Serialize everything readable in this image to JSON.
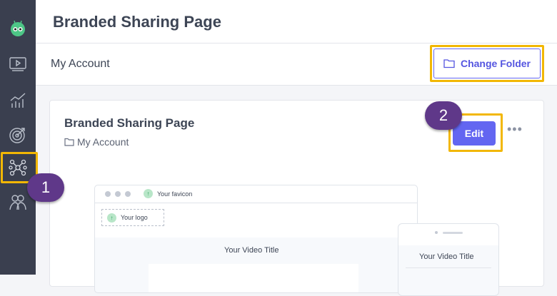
{
  "header": {
    "title": "Branded Sharing Page"
  },
  "subheader": {
    "title": "My Account",
    "change_folder_label": "Change Folder"
  },
  "card": {
    "title": "Branded Sharing Page",
    "folder": "My Account",
    "edit_label": "Edit",
    "more_label": "•••"
  },
  "preview": {
    "favicon_label": "Your favicon",
    "logo_label": "Your logo",
    "video_title": "Your Video Title",
    "mobile_video_title": "Your Video Title"
  },
  "callouts": {
    "one": "1",
    "two": "2"
  },
  "sidebar": {
    "items": [
      {
        "icon": "logo-icon"
      },
      {
        "icon": "video-icon"
      },
      {
        "icon": "analytics-icon"
      },
      {
        "icon": "target-icon"
      },
      {
        "icon": "integrations-icon",
        "active": true
      },
      {
        "icon": "team-icon"
      }
    ]
  },
  "colors": {
    "accent": "#6366f1",
    "highlight": "#f2b705",
    "callout": "#5f3889",
    "sidebar": "#3a3f4f"
  }
}
